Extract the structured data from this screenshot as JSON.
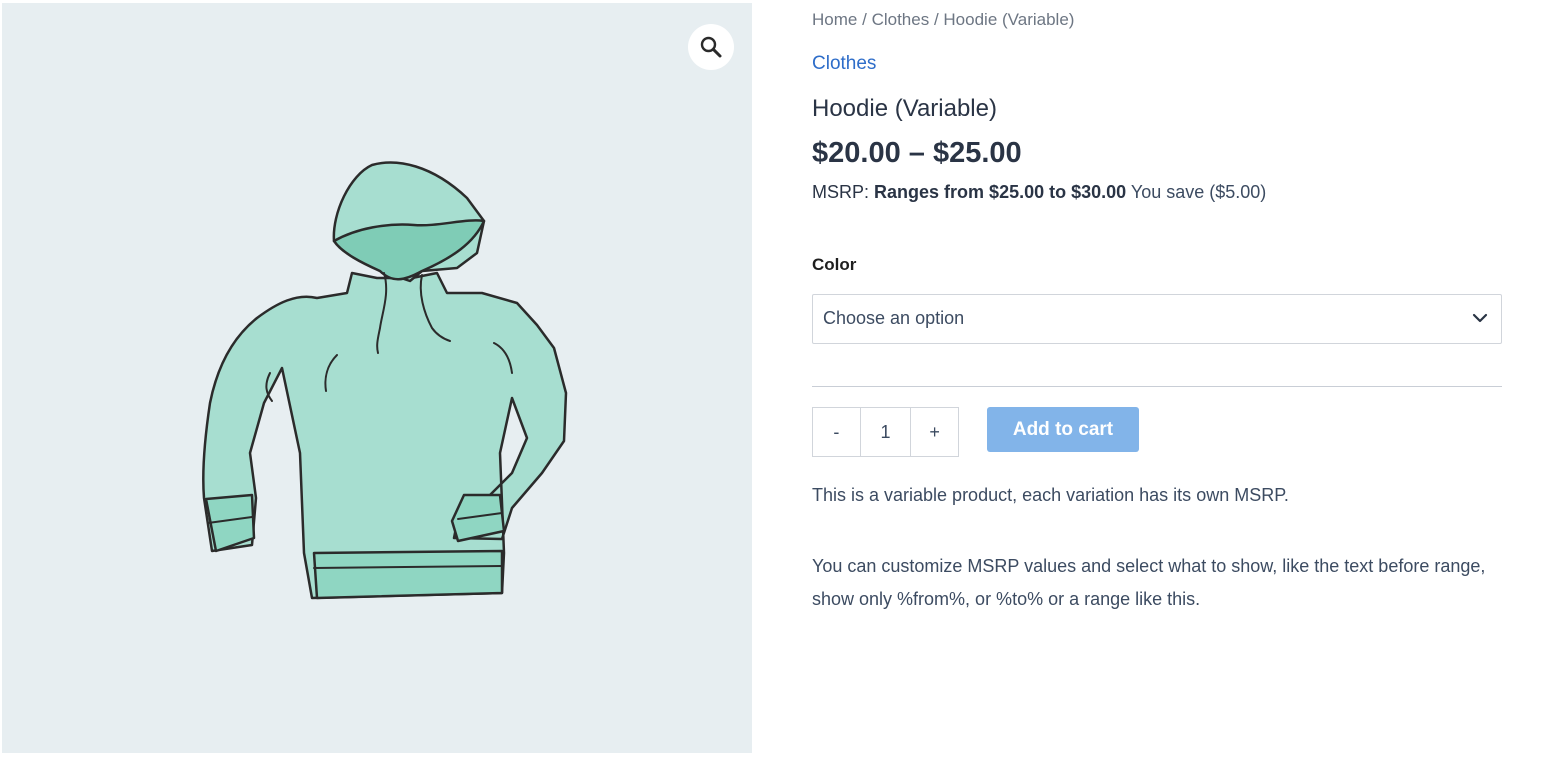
{
  "breadcrumb": {
    "home": "Home",
    "sep1": "/",
    "category": "Clothes",
    "sep2": "/",
    "current": "Hoodie (Variable)"
  },
  "product": {
    "category_link": "Clothes",
    "title": "Hoodie (Variable)",
    "price": "$20.00 – $25.00",
    "msrp_label": "MSRP:",
    "msrp_range": "Ranges from $25.00 to $30.00",
    "you_save": "You save ($5.00)",
    "color_label": "Color",
    "color_select_value": "Choose an option",
    "qty_minus": "-",
    "qty_value": "1",
    "qty_plus": "+",
    "add_to_cart": "Add to cart",
    "description_1": "This is a variable product, each variation has its own MSRP.",
    "description_2": "You can customize MSRP values and select what to show, like the text before range, show only %from%, or %to% or a range like this."
  },
  "icons": {
    "zoom": "magnifier-icon",
    "select": "chevron-down-icon"
  },
  "colors": {
    "link": "#2e6dc9",
    "button": "#82b4e9",
    "gallery_bg": "#e7eef1",
    "hoodie": "#8fd6c2"
  }
}
